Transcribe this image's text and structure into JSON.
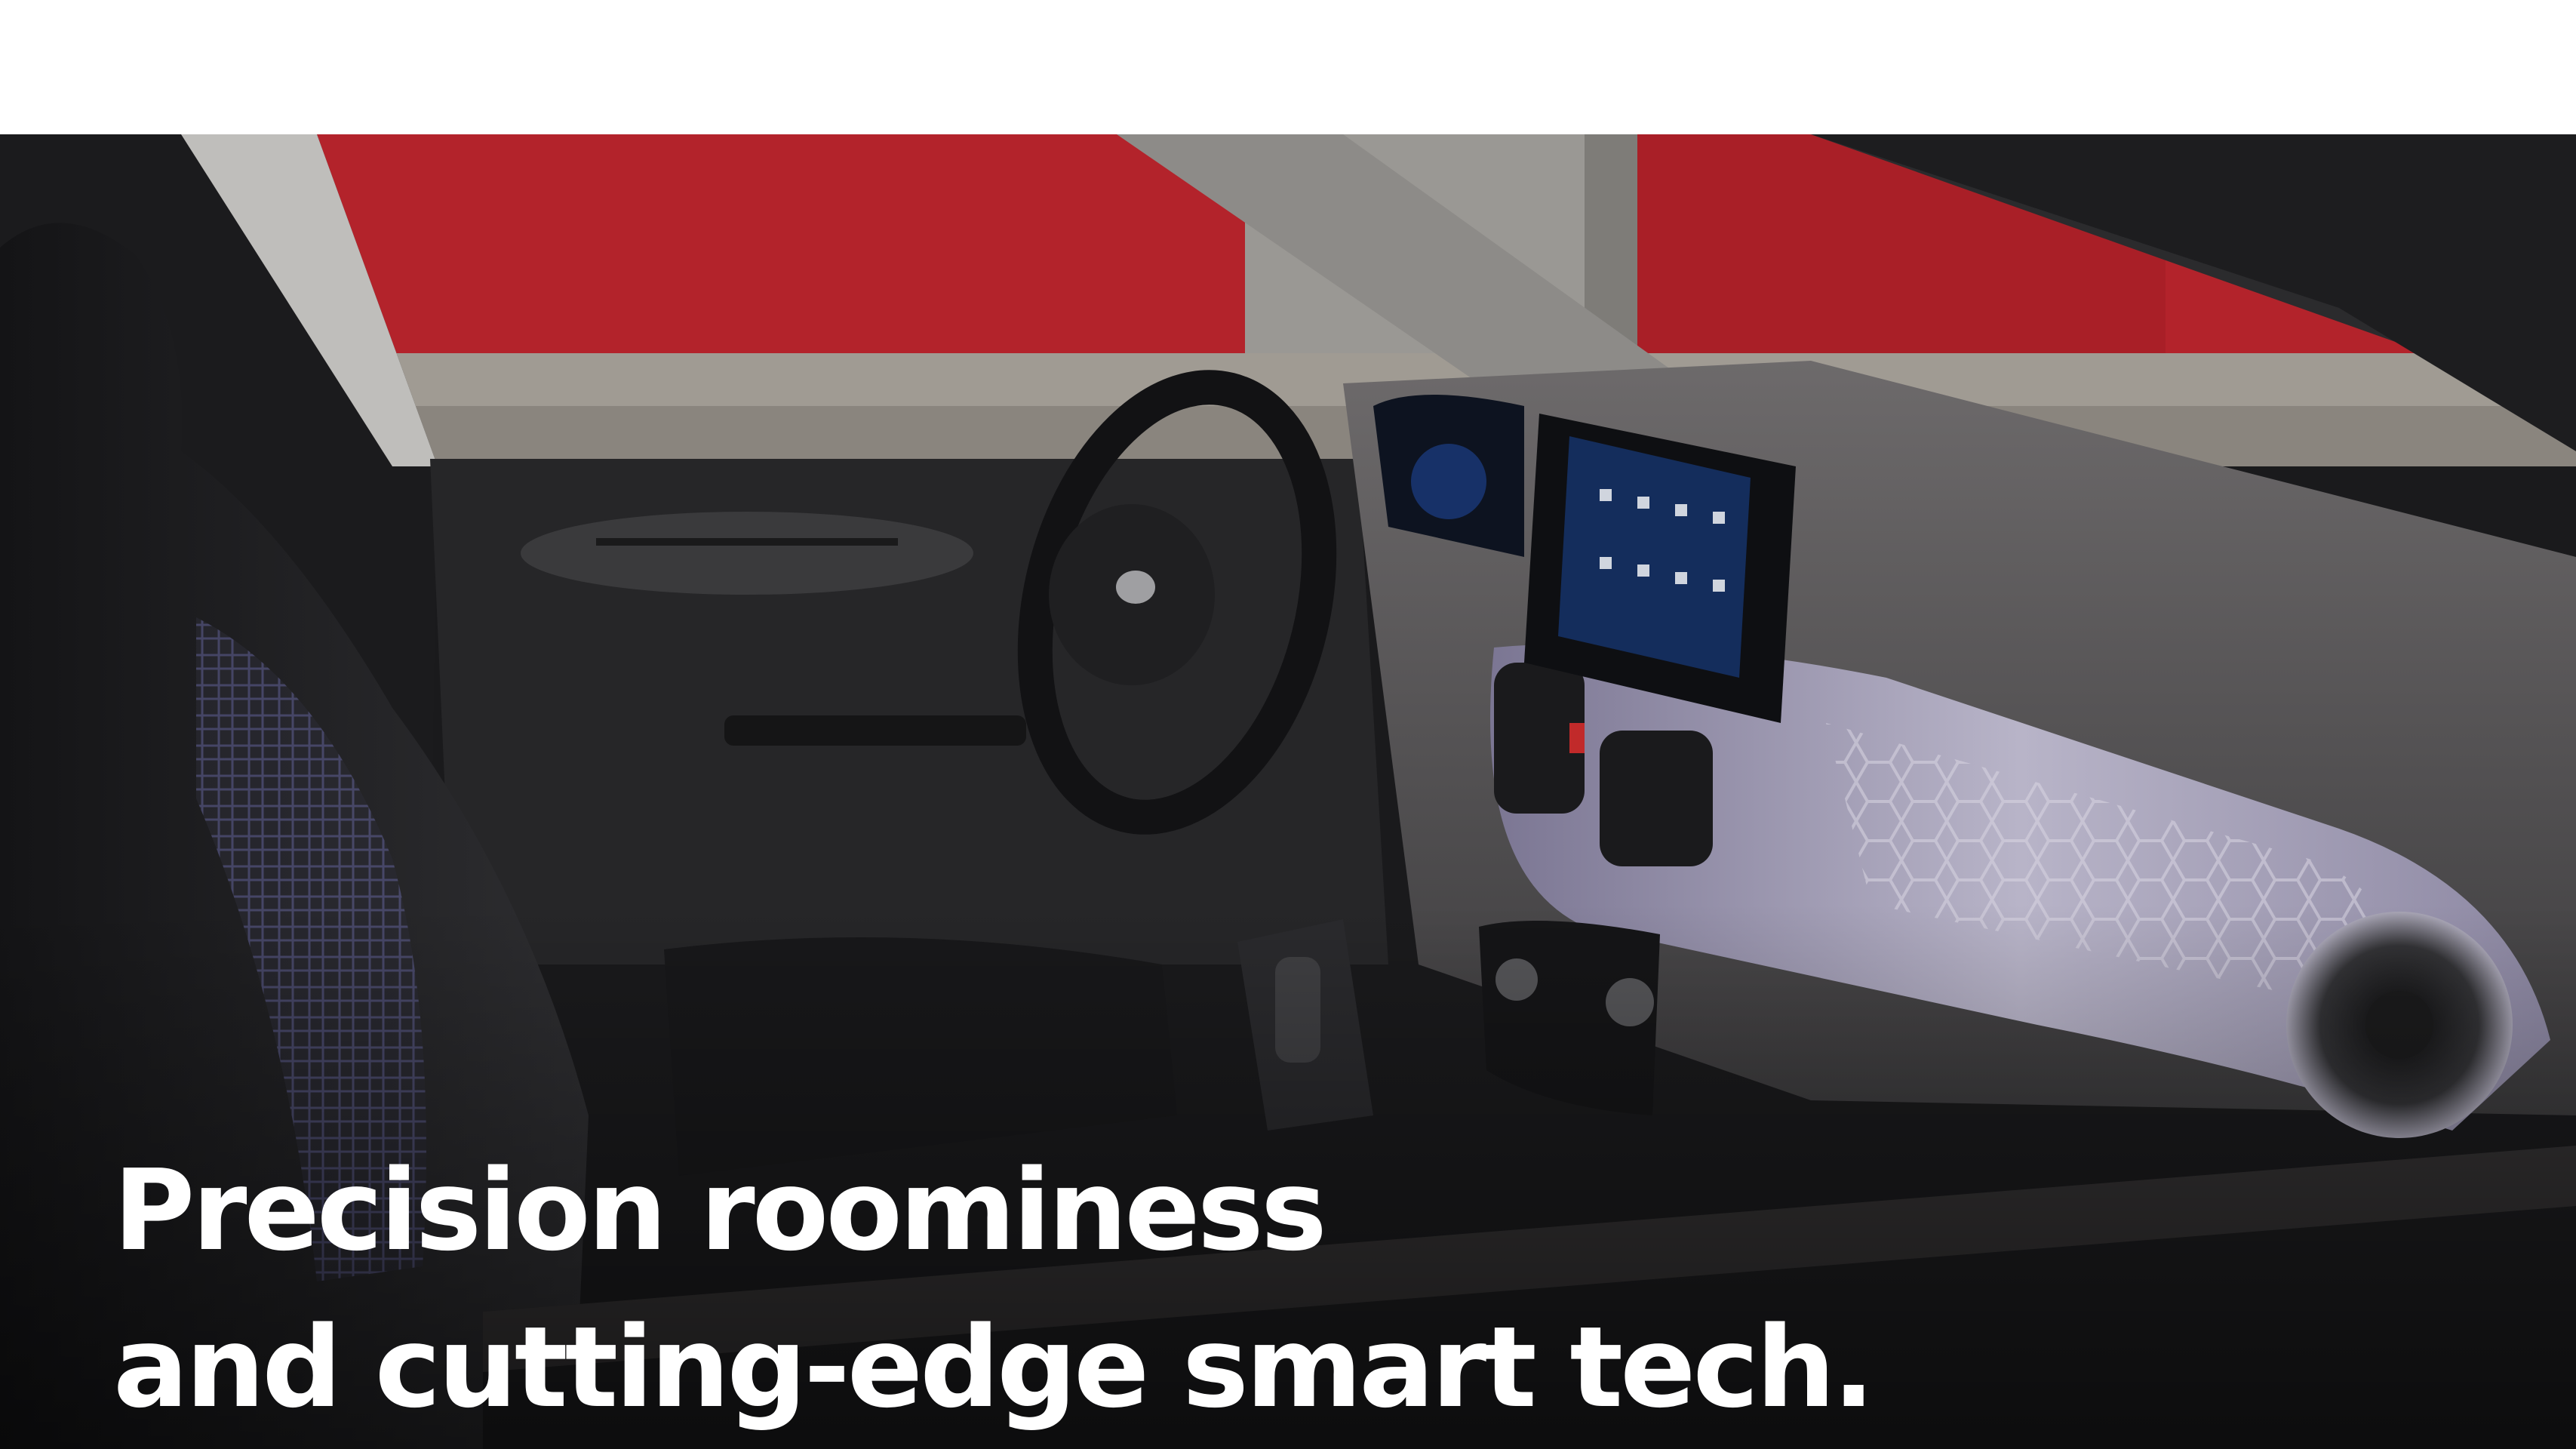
{
  "hero": {
    "headline_line1": "Precision roominess",
    "headline_line2": "and cutting-edge smart tech.",
    "image_alt": "car interior with dashboard, steering wheel and infotainment screen"
  },
  "colors": {
    "background": "#ffffff",
    "headline_text": "#ffffff",
    "exterior_wall": "#b3232b",
    "dash_trim": "#9a95ad",
    "cabin_dark": "#1c1c1e"
  }
}
